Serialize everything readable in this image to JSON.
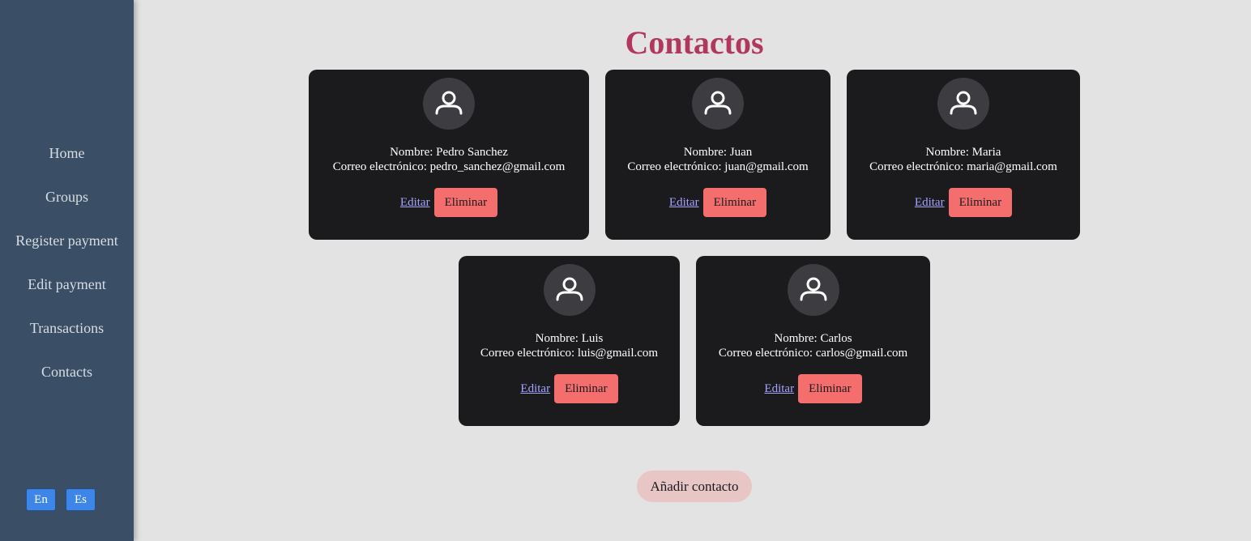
{
  "sidebar": {
    "items": [
      {
        "label": "Home"
      },
      {
        "label": "Groups"
      },
      {
        "label": "Register payment"
      },
      {
        "label": "Edit payment"
      },
      {
        "label": "Transactions"
      },
      {
        "label": "Contacts"
      }
    ],
    "languages": [
      "En",
      "Es"
    ]
  },
  "page": {
    "title": "Contactos",
    "add_label": "Añadir contacto"
  },
  "contacts": [
    {
      "name": "Nombre: Pedro Sanchez",
      "email": "Correo electrónico: pedro_sanchez@gmail.com",
      "edit": "Editar",
      "delete": "Eliminar"
    },
    {
      "name": "Nombre: Juan",
      "email": "Correo electrónico: juan@gmail.com",
      "edit": "Editar",
      "delete": "Eliminar"
    },
    {
      "name": "Nombre: Maria",
      "email": "Correo electrónico: maria@gmail.com",
      "edit": "Editar",
      "delete": "Eliminar"
    },
    {
      "name": "Nombre: Luis",
      "email": "Correo electrónico: luis@gmail.com",
      "edit": "Editar",
      "delete": "Eliminar"
    },
    {
      "name": "Nombre: Carlos",
      "email": "Correo electrónico: carlos@gmail.com",
      "edit": "Editar",
      "delete": "Eliminar"
    }
  ],
  "icons": {
    "avatar": "user-icon"
  },
  "colors": {
    "sidebar_bg": "#3a4e65",
    "title": "#b0385c",
    "card_bg": "#1b1b1e",
    "delete_button": "#f46e6e",
    "add_button": "#e8c6c6",
    "language_button": "#3d86e8"
  }
}
